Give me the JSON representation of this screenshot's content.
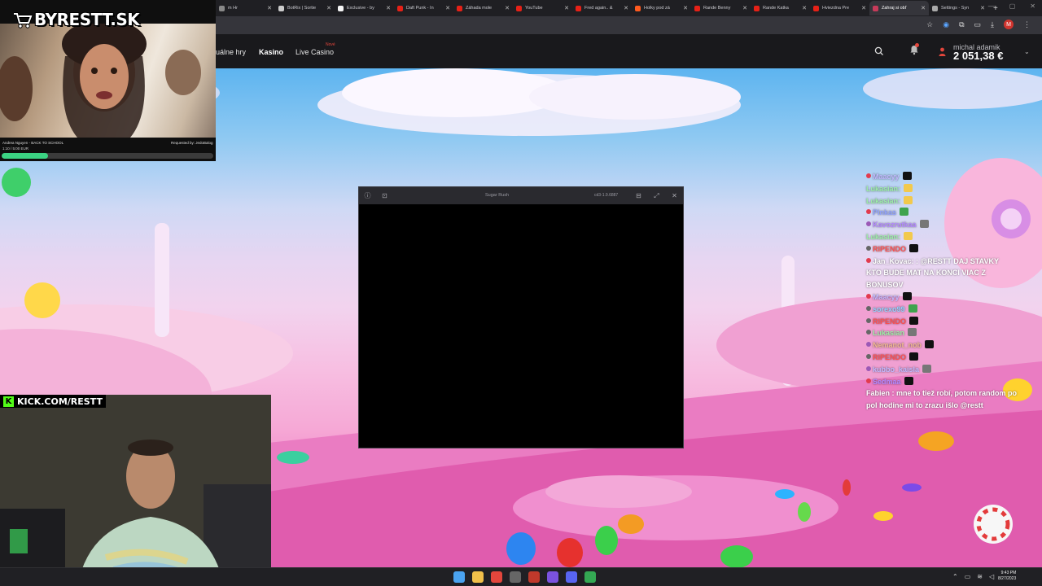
{
  "browser": {
    "tabs": [
      {
        "label": "m Hr",
        "color": "#888",
        "active": false
      },
      {
        "label": "BotRix | Sortie",
        "color": "#ccc",
        "active": false
      },
      {
        "label": "Exclusive - by",
        "color": "#f5f5f5",
        "active": false
      },
      {
        "label": "Daft Punk - In",
        "color": "#e62117",
        "active": false
      },
      {
        "label": "Záhada mole",
        "color": "#e62117",
        "active": false
      },
      {
        "label": "YouTube",
        "color": "#e62117",
        "active": false
      },
      {
        "label": "Fred again.. &",
        "color": "#e62117",
        "active": false
      },
      {
        "label": "Holky pod zá",
        "color": "#ff5a1f",
        "active": false
      },
      {
        "label": "Rande Benny",
        "color": "#e62117",
        "active": false
      },
      {
        "label": "Rande Katka",
        "color": "#e62117",
        "active": false
      },
      {
        "label": "Hviezdna Pre",
        "color": "#e62117",
        "active": false
      },
      {
        "label": "Zahraj si obľ",
        "color": "#c73b5a",
        "active": true
      },
      {
        "label": "Settings - Syn",
        "color": "#aaa",
        "active": false
      }
    ],
    "profile_initial": "M"
  },
  "casino": {
    "nav": [
      "uálne hry",
      "Kasino",
      "Live Casino"
    ],
    "nav_badge": "Nové",
    "username": "michal adamik",
    "balance": "2 051,38 €"
  },
  "game_window": {
    "title": "Sugar Rush",
    "version": "cd3-1.9.6887"
  },
  "stream": {
    "logo": "BYRESTT.SK",
    "song": "Andrea Nguyen - BACK TO SCHOOL",
    "requested": "Requested by: JedoBalog",
    "time": "1:10 / 5:00 EUR",
    "progress": 0.22,
    "kick": "KICK.COM/RESTT",
    "kick_logo": "K"
  },
  "chat": [
    {
      "user": "Maacyy",
      "color": "#c2b9ff",
      "badge": "#e23b4e",
      "emote": "#111"
    },
    {
      "user": "Lukasian:",
      "color": "#9cf0a7",
      "badge": "",
      "emote": "#f2c94c"
    },
    {
      "user": "Lukasian:",
      "color": "#9cf0a7",
      "badge": "",
      "emote": "#f2c94c"
    },
    {
      "user": "Pinkas",
      "color": "#8fa2ff",
      "badge": "#e23b4e",
      "emote": "#3fa34d"
    },
    {
      "user": "Kavozrutkaa",
      "color": "#b388ff",
      "badge": "#9b59b6",
      "emote": "#777"
    },
    {
      "user": "Lukasian:",
      "color": "#9cf0a7",
      "badge": "",
      "emote": "#f2c94c"
    },
    {
      "user": "RIPENDO",
      "color": "#ff4d4d",
      "badge": "#666",
      "emote": "#111"
    },
    {
      "user": "Jan_Kovac: : @RESTT DAJ STAVKY",
      "color": "#ffffff",
      "badge": "#e23b4e",
      "emote": ""
    },
    {
      "user": "KTO BUDE MAT NA KONCI VIAC Z",
      "color": "#ffffff",
      "badge": "",
      "emote": ""
    },
    {
      "user": "BONUSOV",
      "color": "#ffffff",
      "badge": "",
      "emote": ""
    },
    {
      "user": "Maacyy",
      "color": "#c2b9ff",
      "badge": "#e23b4e",
      "emote": "#111"
    },
    {
      "user": "sorexo99",
      "color": "#8fd3ff",
      "badge": "#666",
      "emote": "#3fa34d"
    },
    {
      "user": "RIPENDO",
      "color": "#ff4d4d",
      "badge": "#666",
      "emote": "#111"
    },
    {
      "user": "Lukasian",
      "color": "#9cf0a7",
      "badge": "#666",
      "emote": "#777"
    },
    {
      "user": "Nemanot_nob",
      "color": "#f0b98f",
      "badge": "#9b59b6",
      "emote": "#111"
    },
    {
      "user": "RIPENDO",
      "color": "#ff4d4d",
      "badge": "#666",
      "emote": "#111"
    },
    {
      "user": "kubbo_kaisla",
      "color": "#c2b9ff",
      "badge": "#9b59b6",
      "emote": "#777"
    },
    {
      "user": "Sedmaa",
      "color": "#b388ff",
      "badge": "#e23b4e",
      "emote": "#111"
    },
    {
      "user": "Fabien : mne to tiež robí, potom random po",
      "color": "#ffffff",
      "badge": "",
      "emote": ""
    },
    {
      "user": "pol hodine mi to zrazu išlo @restt",
      "color": "#ffffff",
      "badge": "",
      "emote": ""
    }
  ],
  "taskbar": {
    "time": "9:43 PM",
    "date": "8/27/2023"
  },
  "colors": {
    "accent": "#e2463c",
    "header_bg": "#19191c",
    "kick_green": "#53fc18"
  }
}
